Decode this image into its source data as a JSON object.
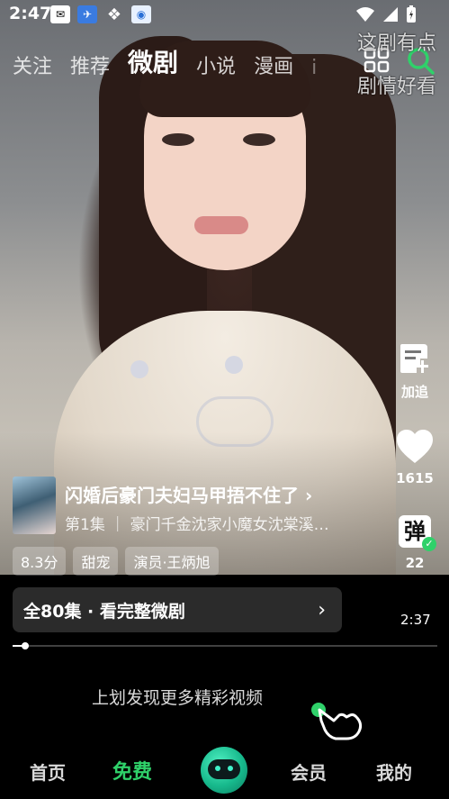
{
  "status_bar": {
    "time": "2:47",
    "app_icons": [
      "mail-icon",
      "bird-icon",
      "fourleaf-icon",
      "app-icon"
    ]
  },
  "top_nav": {
    "tabs": [
      "关注",
      "推荐",
      "微剧",
      "小说",
      "漫画",
      "i"
    ],
    "active_tab": "微剧"
  },
  "overlay_comments": [
    "这剧有点",
    "剧情好看"
  ],
  "right_rail": {
    "follow_label": "加追",
    "like_count": "1615",
    "danmaku_glyph": "弹",
    "danmaku_count": "22"
  },
  "drama": {
    "title": "闪婚后豪门夫妇马甲捂不住了",
    "title_arrow": "›",
    "subtitle": "第1集 ｜ 豪门千金沈家小魔女沈棠溪…",
    "tags": [
      "8.3分",
      "甜宠",
      "演员·王炳旭"
    ]
  },
  "watch_bar": {
    "label": "全80集 · 看完整微剧",
    "arrow": "›"
  },
  "player": {
    "duration": "2:37",
    "progress": 0.03
  },
  "swipe_hint": "上划发现更多精彩视频",
  "bottom_nav": {
    "items": [
      "首页",
      "免费",
      "会员",
      "我的"
    ],
    "active": "免费"
  },
  "colors": {
    "accent": "#2fd16a",
    "bar": "#2b2b2b"
  }
}
